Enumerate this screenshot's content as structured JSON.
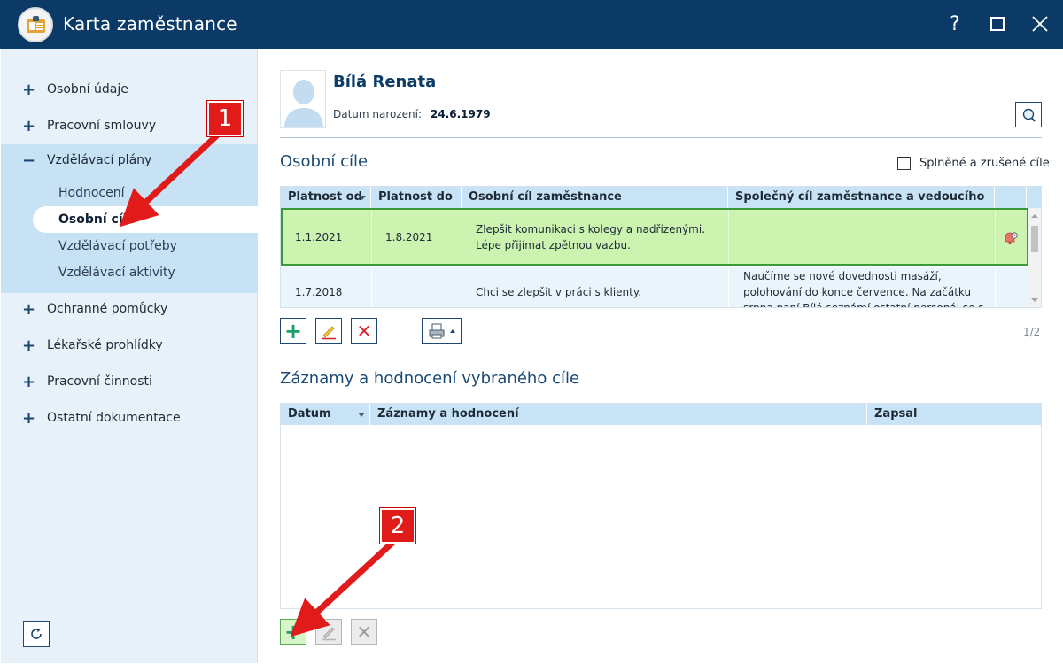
{
  "window": {
    "title": "Karta zaměstnance",
    "help_label": "?",
    "colors": {
      "titlebar": "#0b3a66",
      "sidebar": "#e6f1f9",
      "accent": "#1c4872"
    }
  },
  "sidebar": {
    "items": [
      {
        "sign": "+",
        "label": "Osobní údaje"
      },
      {
        "sign": "+",
        "label": "Pracovní smlouvy"
      },
      {
        "sign": "−",
        "label": "Vzdělávací plány"
      },
      {
        "sign": "+",
        "label": "Ochranné pomůcky"
      },
      {
        "sign": "+",
        "label": "Lékařské prohlídky"
      },
      {
        "sign": "+",
        "label": "Pracovní činnosti"
      },
      {
        "sign": "+",
        "label": "Ostatní dokumentace"
      }
    ],
    "subitems": [
      {
        "label": "Hodnocení"
      },
      {
        "label": "Osobní cíle"
      },
      {
        "label": "Vzdělávací potřeby"
      },
      {
        "label": "Vzdělávací aktivity"
      }
    ]
  },
  "employee": {
    "name": "Bílá Renata",
    "dob_label": "Datum narození:",
    "dob_value": "24.6.1979"
  },
  "goals": {
    "title": "Osobní cíle",
    "checkbox_label": "Splněné a zrušené cíle",
    "columns": [
      "Platnost od",
      "Platnost do",
      "Osobní cíl zaměstnance",
      "Společný cíl zaměstnance a vedoucího"
    ],
    "rows": [
      {
        "from": "1.1.2021",
        "to": "1.8.2021",
        "goal_line1": "Zlepšit komunikaci s kolegy a nadřízenými.",
        "goal_line2": "Lépe přijímat zpětnou vazbu.",
        "shared_line1": "",
        "shared_line2": "",
        "shared_line3": ""
      },
      {
        "from": "1.7.2018",
        "to": "",
        "goal_line1": "Chci se zlepšit v práci s klienty.",
        "goal_line2": "",
        "shared_line1": "Naučíme se nové dovednosti masáží,",
        "shared_line2": "polohování do konce července. Na začátku",
        "shared_line3": "srpna paní Bílá seznámí ostatní personál se s"
      }
    ],
    "pager": "1/2"
  },
  "records": {
    "title": "Záznamy a hodnocení vybraného cíle",
    "columns": [
      "Datum",
      "Záznamy a hodnocení",
      "Zapsal"
    ]
  },
  "callouts": [
    {
      "number": "1"
    },
    {
      "number": "2"
    }
  ]
}
